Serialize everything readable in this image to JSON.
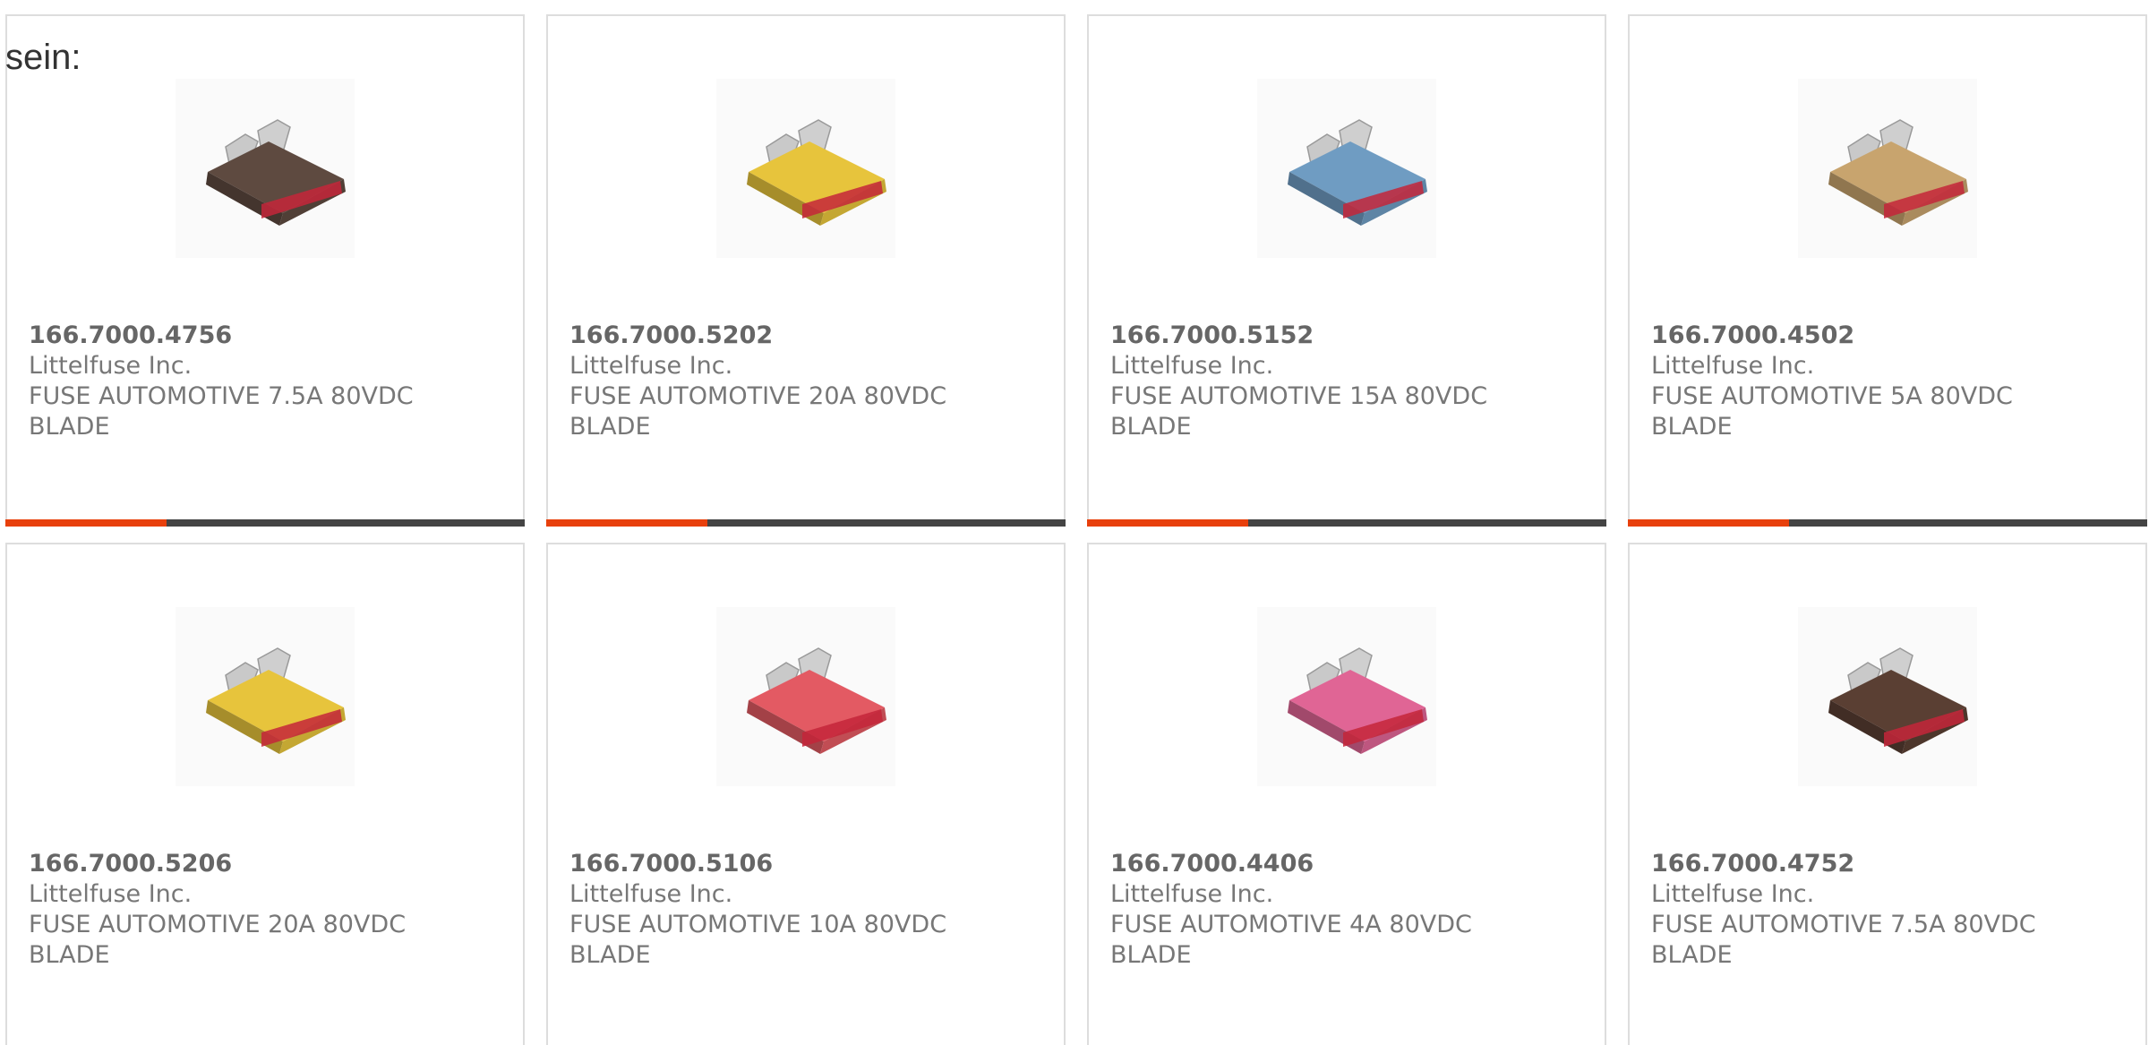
{
  "intro_text": "sein:",
  "products": [
    {
      "part_number": "166.7000.4756",
      "manufacturer": "Littelfuse Inc.",
      "description_line1": "FUSE AUTOMOTIVE 7.5A 80VDC",
      "description_line2": "BLADE",
      "fuse_color": "#5e4a40",
      "progress": 0.31
    },
    {
      "part_number": "166.7000.5202",
      "manufacturer": "Littelfuse Inc.",
      "description_line1": "FUSE AUTOMOTIVE 20A 80VDC",
      "description_line2": "BLADE",
      "fuse_color": "#e7c43c",
      "progress": 0.31
    },
    {
      "part_number": "166.7000.5152",
      "manufacturer": "Littelfuse Inc.",
      "description_line1": "FUSE AUTOMOTIVE 15A 80VDC",
      "description_line2": "BLADE",
      "fuse_color": "#6f9cc2",
      "progress": 0.31
    },
    {
      "part_number": "166.7000.4502",
      "manufacturer": "Littelfuse Inc.",
      "description_line1": "FUSE AUTOMOTIVE 5A 80VDC",
      "description_line2": "BLADE",
      "fuse_color": "#c8a46e",
      "progress": 0.31
    },
    {
      "part_number": "166.7000.5206",
      "manufacturer": "Littelfuse Inc.",
      "description_line1": "FUSE AUTOMOTIVE 20A 80VDC",
      "description_line2": "BLADE",
      "fuse_color": "#e7c43c"
    },
    {
      "part_number": "166.7000.5106",
      "manufacturer": "Littelfuse Inc.",
      "description_line1": "FUSE AUTOMOTIVE 10A 80VDC",
      "description_line2": "BLADE",
      "fuse_color": "#e35a63"
    },
    {
      "part_number": "166.7000.4406",
      "manufacturer": "Littelfuse Inc.",
      "description_line1": "FUSE AUTOMOTIVE 4A 80VDC",
      "description_line2": "BLADE",
      "fuse_color": "#e06595"
    },
    {
      "part_number": "166.7000.4752",
      "manufacturer": "Littelfuse Inc.",
      "description_line1": "FUSE AUTOMOTIVE 7.5A 80VDC",
      "description_line2": "BLADE",
      "fuse_color": "#5a3f33"
    }
  ]
}
